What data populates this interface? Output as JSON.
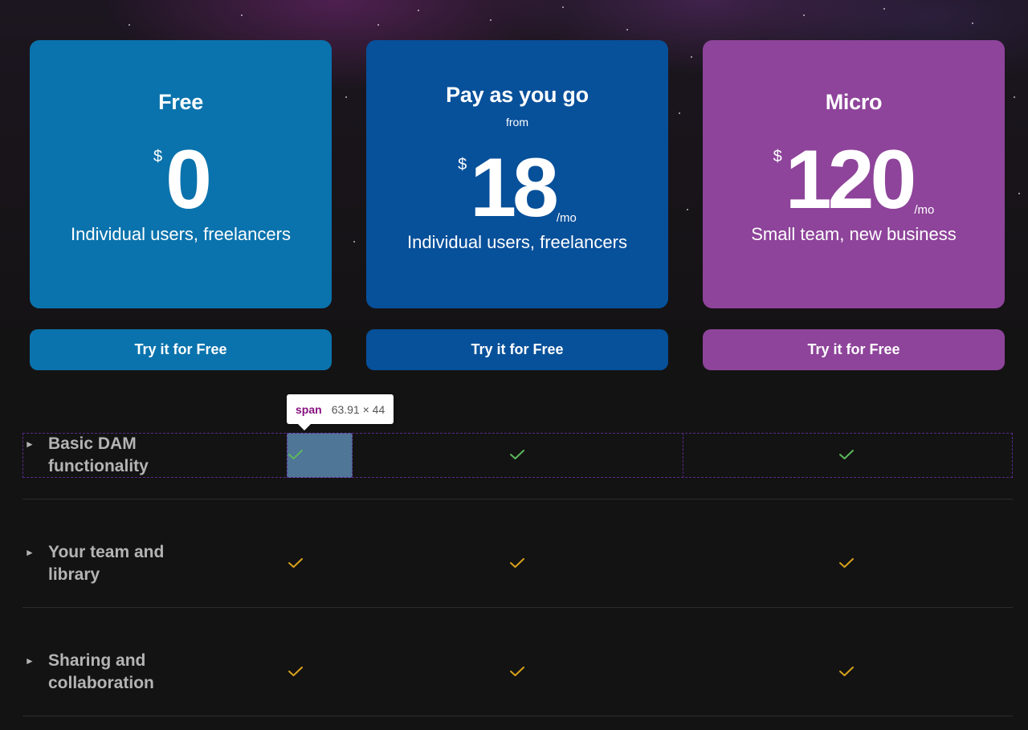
{
  "plans": [
    {
      "name": "Free",
      "from": "",
      "currency": "$",
      "amount": "0",
      "per": "",
      "audience": "Individual users, freelancers",
      "cta": "Try it for Free",
      "color": "#0a73ad"
    },
    {
      "name": "Pay as you go",
      "from": "from",
      "currency": "$",
      "amount": "18",
      "per": "/mo",
      "audience": "Individual users, freelancers",
      "cta": "Try it for Free",
      "color": "#07509a"
    },
    {
      "name": "Micro",
      "from": "",
      "currency": "$",
      "amount": "120",
      "per": "/mo",
      "audience": "Small team, new business",
      "cta": "Try it for Free",
      "color": "#8e449a"
    }
  ],
  "devtools_tooltip": {
    "tag": "span",
    "dimensions": "63.91 × 44"
  },
  "features": [
    {
      "line1": "Basic DAM",
      "line2": "functionality",
      "expand_icon": "caret-right-icon",
      "check_icon": "checkmark-icon",
      "check_color": "#5cb85c",
      "included": [
        true,
        true,
        true
      ]
    },
    {
      "line1": "Your team and",
      "line2": "library",
      "expand_icon": "caret-right-icon",
      "check_icon": "checkmark-icon",
      "check_color": "#d9a21b",
      "included": [
        true,
        true,
        true
      ]
    },
    {
      "line1": "Sharing and",
      "line2": "collaboration",
      "expand_icon": "caret-right-icon",
      "check_icon": "checkmark-icon",
      "check_color": "#d9a21b",
      "included": [
        true,
        true,
        true
      ]
    }
  ],
  "colors": {
    "background": "#131313",
    "feature_text": "#b4b4b4",
    "devtools_highlight": "#6fa8dc"
  }
}
